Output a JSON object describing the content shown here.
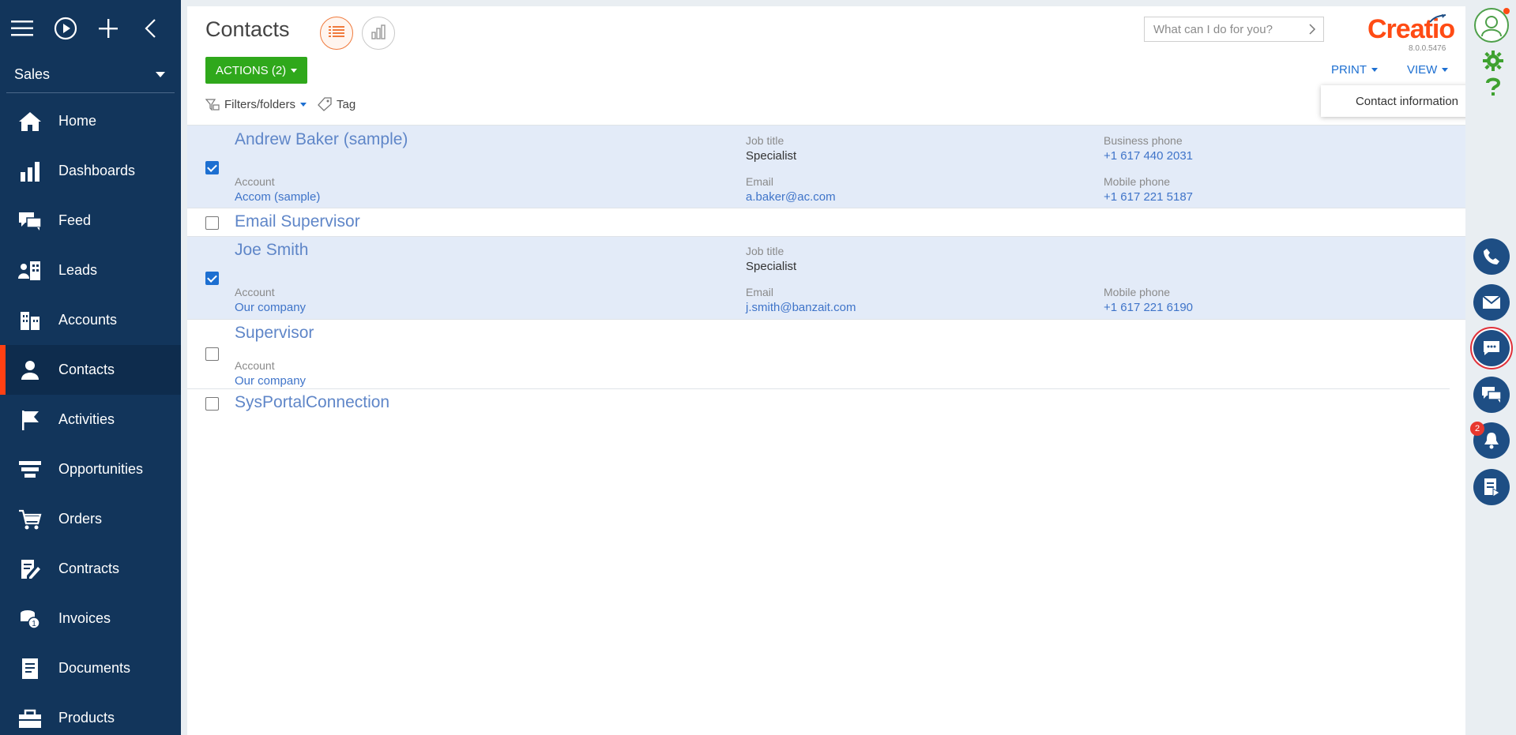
{
  "sidebar": {
    "workspace": "Sales",
    "items": [
      {
        "label": "Home",
        "icon": "home-icon"
      },
      {
        "label": "Dashboards",
        "icon": "dashboards-icon"
      },
      {
        "label": "Feed",
        "icon": "feed-icon"
      },
      {
        "label": "Leads",
        "icon": "leads-icon"
      },
      {
        "label": "Accounts",
        "icon": "accounts-icon"
      },
      {
        "label": "Contacts",
        "icon": "contacts-icon",
        "active": true
      },
      {
        "label": "Activities",
        "icon": "activities-icon"
      },
      {
        "label": "Opportunities",
        "icon": "opportunities-icon"
      },
      {
        "label": "Orders",
        "icon": "orders-icon"
      },
      {
        "label": "Contracts",
        "icon": "contracts-icon"
      },
      {
        "label": "Invoices",
        "icon": "invoices-icon"
      },
      {
        "label": "Documents",
        "icon": "documents-icon"
      },
      {
        "label": "Products",
        "icon": "products-icon"
      }
    ]
  },
  "header": {
    "title": "Contacts",
    "actions_label": "ACTIONS (2)",
    "filters_label": "Filters/folders",
    "tag_label": "Tag",
    "search_placeholder": "What can I do for you?",
    "logo": "Creatio",
    "version": "8.0.0.5476",
    "print_label": "PRINT",
    "view_label": "VIEW",
    "dropdown_item": "Contact information"
  },
  "labels": {
    "job_title": "Job title",
    "business_phone": "Business phone",
    "account": "Account",
    "email": "Email",
    "mobile_phone": "Mobile phone"
  },
  "contacts": [
    {
      "name": "Andrew Baker (sample)",
      "selected": true,
      "job_title": "Specialist",
      "business_phone": "+1 617 440 2031",
      "account": "Accom (sample)",
      "email": "a.baker@ac.com",
      "mobile_phone": "+1 617 221 5187"
    },
    {
      "name": "Email Supervisor",
      "selected": false
    },
    {
      "name": "Joe Smith",
      "selected": true,
      "job_title": "Specialist",
      "account": "Our company",
      "email": "j.smith@banzait.com",
      "mobile_phone": "+1 617 221 6190"
    },
    {
      "name": "Supervisor",
      "selected": false,
      "account": "Our company"
    },
    {
      "name": "SysPortalConnection",
      "selected": false
    }
  ],
  "rightbar": {
    "notification_count": "2"
  },
  "colors": {
    "sidebar_bg": "#12355b",
    "active_accent": "#ff4013",
    "actions_green": "#2fa81b",
    "link_blue": "#1d6fd1",
    "selected_row": "#e3ebf8"
  }
}
